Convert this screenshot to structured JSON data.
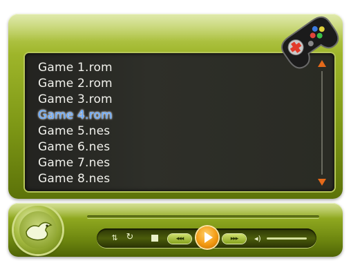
{
  "games": [
    {
      "label": "Game 1.rom",
      "selected": false
    },
    {
      "label": "Game 2.rom",
      "selected": false
    },
    {
      "label": "Game 3.rom",
      "selected": false
    },
    {
      "label": "Game 4.rom",
      "selected": true
    },
    {
      "label": "Game 5.nes",
      "selected": false
    },
    {
      "label": "Game 6.nes",
      "selected": false
    },
    {
      "label": "Game 7.nes",
      "selected": false
    },
    {
      "label": "Game 8.nes",
      "selected": false
    }
  ],
  "icons": {
    "logo": "gamepad-icon",
    "badge": "duck-emblem-icon",
    "scroll_up": "scroll-up-arrow-icon",
    "scroll_down": "scroll-down-arrow-icon",
    "repeat": "repeat-icon",
    "refresh": "refresh-icon",
    "stop": "stop-icon",
    "prev": "previous-icon",
    "play": "play-icon",
    "next": "next-icon",
    "volume": "volume-icon"
  },
  "colors": {
    "theme_green": "#8ea71f",
    "list_bg": "#2a2b24",
    "selected_text": "#5fa5ff",
    "accent_orange": "#f39a12"
  }
}
